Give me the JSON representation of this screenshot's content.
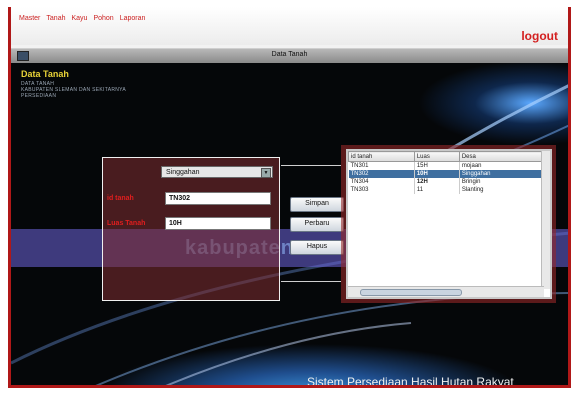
{
  "menu": [
    "Master",
    "Tanah",
    "Kayu",
    "Pohon",
    "Laporan"
  ],
  "logout_label": "logout",
  "window": {
    "title": "Data Tanah"
  },
  "logo": {
    "title": "Data Tanah",
    "line1": "DATA TANAH",
    "line2": "KABUPATEN SLEMAN DAN SEKITARNYA",
    "line3": "PERSEDIAAN"
  },
  "form": {
    "combo_value": "Singgahan",
    "id_label": "id tanah",
    "id_value": "TN302",
    "luas_label": "Luas Tanah",
    "luas_value": "10H"
  },
  "buttons": {
    "simpan": "Simpan",
    "perbaru": "Perbaru",
    "hapus": "Hapus"
  },
  "watermark": "kabupaten",
  "table": {
    "headers": [
      "id tanah",
      "Luas",
      "Desa"
    ],
    "rows": [
      [
        "TN301",
        "15H",
        "mojaan"
      ],
      [
        "TN302",
        "10H",
        "Singgahan"
      ],
      [
        "TN304",
        "12H",
        "Bringin"
      ],
      [
        "TN303",
        "11",
        "Slanting"
      ]
    ],
    "selected_row": 1
  },
  "footer": "Sistem Persediaan Hasil Hutan Rakyat",
  "colors": {
    "accent": "#d32020",
    "selection": "#3f6fa0",
    "frame": "#b01818"
  }
}
